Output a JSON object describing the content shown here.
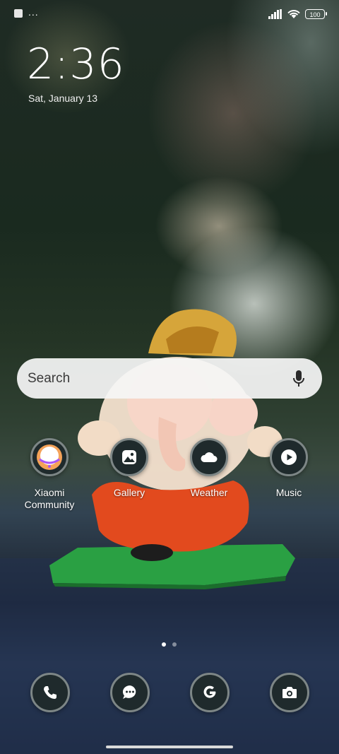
{
  "status_bar": {
    "notification_icon": "square-notification-icon",
    "more_indicator": "...",
    "battery_level": "100"
  },
  "lock": {
    "time": "2:36",
    "date": "Sat, January 13"
  },
  "search": {
    "placeholder": "Search",
    "mic_icon": "mic-icon"
  },
  "apps": [
    {
      "label": "Xiaomi\nCommunity",
      "icon": "xiaomi-community-icon"
    },
    {
      "label": "Gallery",
      "icon": "gallery-icon"
    },
    {
      "label": "Weather",
      "icon": "weather-icon"
    },
    {
      "label": "Music",
      "icon": "music-icon"
    }
  ],
  "page_indicator": {
    "pages": 2,
    "current": 1
  },
  "dock": [
    {
      "name": "Phone",
      "icon": "phone-icon"
    },
    {
      "name": "Messages",
      "icon": "messages-icon"
    },
    {
      "name": "Google",
      "icon": "google-icon"
    },
    {
      "name": "Camera",
      "icon": "camera-icon"
    }
  ],
  "colors": {
    "icon_bg": "#1f2a2c",
    "icon_ring": "#7d8686",
    "search_bg": "#f5f5f5"
  }
}
